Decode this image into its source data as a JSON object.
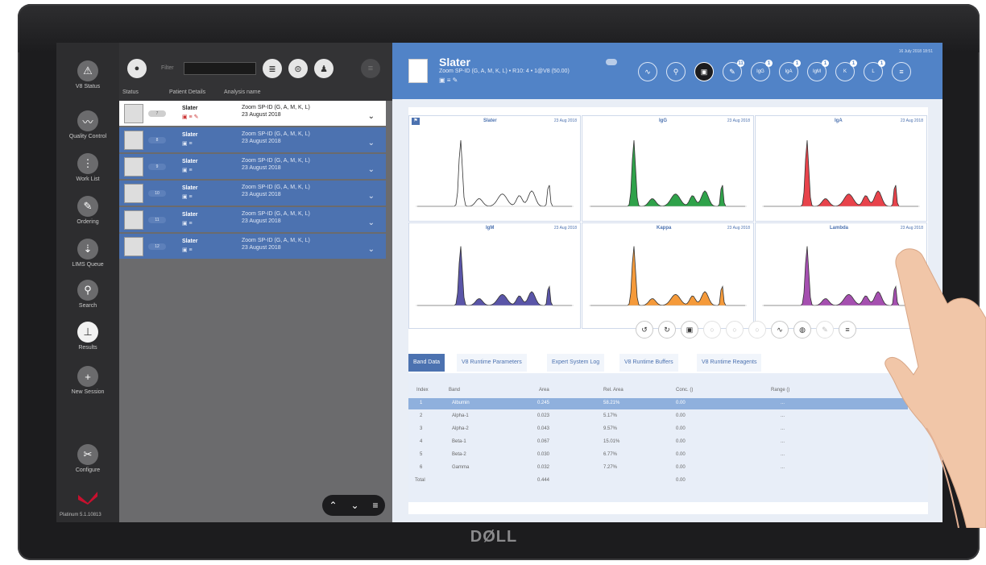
{
  "device": {
    "brand_logo": "DØLL"
  },
  "nav": {
    "items": [
      {
        "label": "V8 Status",
        "icon": "⚠"
      },
      {
        "label": "Quality Control",
        "icon": "〰"
      },
      {
        "label": "Work List",
        "icon": "⋮"
      },
      {
        "label": "Ordering",
        "icon": "✎"
      },
      {
        "label": "LIMS Queue",
        "icon": "⇣"
      },
      {
        "label": "Search",
        "icon": "⚲"
      },
      {
        "label": "Results",
        "icon": "⊥"
      },
      {
        "label": "New Session",
        "icon": "+"
      },
      {
        "label": "Configure",
        "icon": "✂"
      }
    ],
    "version": "Platinum 5.1.10813"
  },
  "worklist": {
    "filter_label": "Filter",
    "columns": [
      "Status",
      "Patient Details",
      "Analysis name"
    ],
    "rows": [
      {
        "status": "7",
        "name": "Slater",
        "analysis": "Zoom SP-ID (G, A, M, K, L)",
        "date": "23 August 2018"
      },
      {
        "status": "8",
        "name": "Slater",
        "analysis": "Zoom SP-ID (G, A, M, K, L)",
        "date": "23 August 2018"
      },
      {
        "status": "9",
        "name": "Slater",
        "analysis": "Zoom SP-ID (G, A, M, K, L)",
        "date": "23 August 2018"
      },
      {
        "status": "10",
        "name": "Slater",
        "analysis": "Zoom SP-ID (G, A, M, K, L)",
        "date": "23 August 2018"
      },
      {
        "status": "11",
        "name": "Slater",
        "analysis": "Zoom SP-ID (G, A, M, K, L)",
        "date": "23 August 2018"
      },
      {
        "status": "12",
        "name": "Slater",
        "analysis": "Zoom SP-ID (G, A, M, K, L)",
        "date": "23 August 2018"
      }
    ],
    "pager": [
      "⌃",
      "⌄",
      "≡"
    ]
  },
  "patient": {
    "name": "Slater",
    "subtitle": "Zoom SP-ID (G, A, M, K, L) • R10: 4 • 1@V8 (50.00)",
    "datetime": "16 July 2018 18:51",
    "header_buttons": [
      {
        "name": "gel-button",
        "glyph": "∿",
        "badge": ""
      },
      {
        "name": "search-button",
        "glyph": "⚲",
        "badge": ""
      },
      {
        "name": "flag-button",
        "glyph": "▣",
        "badge": ""
      },
      {
        "name": "attach-button",
        "glyph": "✎",
        "badge": "11"
      },
      {
        "name": "igg-button",
        "glyph": "IgG",
        "badge": "1"
      },
      {
        "name": "iga-button",
        "glyph": "IgA",
        "badge": "1"
      },
      {
        "name": "igm-button",
        "glyph": "IgM",
        "badge": "1"
      },
      {
        "name": "kappa-button",
        "glyph": "K",
        "badge": "1"
      },
      {
        "name": "lambda-button",
        "glyph": "L",
        "badge": "1"
      },
      {
        "name": "menu-button",
        "glyph": "≡",
        "badge": ""
      }
    ]
  },
  "charts": [
    {
      "title": "Slater",
      "date": "23 Aug 2018",
      "color": "#ffffff",
      "flag": "⚑"
    },
    {
      "title": "IgG",
      "date": "23 Aug 2018",
      "color": "#2fa24a",
      "flag": ""
    },
    {
      "title": "IgA",
      "date": "23 Aug 2018",
      "color": "#e8434b",
      "flag": ""
    },
    {
      "title": "IgM",
      "date": "23 Aug 2018",
      "color": "#5a55a8",
      "flag": ""
    },
    {
      "title": "Kappa",
      "date": "23 Aug 2018",
      "color": "#f59a3a",
      "flag": ""
    },
    {
      "title": "Lambda",
      "date": "23 Aug 2018",
      "color": "#a54fb0",
      "flag": ""
    }
  ],
  "toolbar": [
    "↺",
    "↻",
    "▣",
    "○",
    "○",
    "○",
    "∿",
    "◍",
    "✎",
    "≡"
  ],
  "tabs": [
    "Band Data",
    "V8 Runtime Parameters",
    "Expert System Log",
    "V8 Runtime Buffers",
    "V8 Runtime Reagents"
  ],
  "band_table": {
    "headers": [
      "Index",
      "Band",
      "Area",
      "Rel. Area",
      "Conc. ()",
      "Range ()"
    ],
    "rows": [
      {
        "index": "1",
        "band": "Albumin",
        "area": "0.245",
        "rel": "58.21%",
        "conc": "0.00",
        "range": "..."
      },
      {
        "index": "2",
        "band": "Alpha-1",
        "area": "0.023",
        "rel": "5.17%",
        "conc": "0.00",
        "range": "..."
      },
      {
        "index": "3",
        "band": "Alpha-2",
        "area": "0.043",
        "rel": "9.57%",
        "conc": "0.00",
        "range": "..."
      },
      {
        "index": "4",
        "band": "Beta-1",
        "area": "0.067",
        "rel": "15.01%",
        "conc": "0.00",
        "range": "..."
      },
      {
        "index": "5",
        "band": "Beta-2",
        "area": "0.030",
        "rel": "6.77%",
        "conc": "0.00",
        "range": "..."
      },
      {
        "index": "6",
        "band": "Gamma",
        "area": "0.032",
        "rel": "7.27%",
        "conc": "0.00",
        "range": "..."
      }
    ],
    "total_label": "Total",
    "total_area": "0.444",
    "total_conc": "0.00"
  }
}
